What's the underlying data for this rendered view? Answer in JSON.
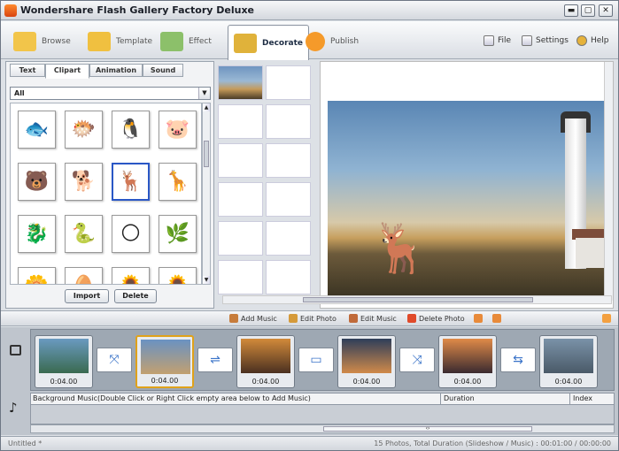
{
  "window": {
    "title": "Wondershare Flash Gallery Factory Deluxe",
    "minimize": "▬",
    "maximize": "▢",
    "close": "✕"
  },
  "toolbar": {
    "modes": [
      {
        "label": "Browse",
        "color": "#f2c54a"
      },
      {
        "label": "Template",
        "color": "#f0c040"
      },
      {
        "label": "Effect",
        "color": "#8cc06a"
      },
      {
        "label": "Decorate",
        "color": "#e0b23a",
        "active": true
      },
      {
        "label": "Publish",
        "color": "#f59a2a"
      }
    ],
    "file": "File",
    "settings": "Settings",
    "help": "Help"
  },
  "decorate": {
    "tabs": [
      "Text",
      "Clipart",
      "Animation",
      "Sound"
    ],
    "active_tab": "Clipart",
    "filter": "All",
    "cliparts": [
      {
        "icon": "black-fish-clipart",
        "glyph": "🐟"
      },
      {
        "icon": "sketch-fish-clipart",
        "glyph": "🐡"
      },
      {
        "icon": "penguin-clipart",
        "glyph": "🐧"
      },
      {
        "icon": "pig-clipart",
        "glyph": "🐷"
      },
      {
        "icon": "black-bear-clipart",
        "glyph": "🐻"
      },
      {
        "icon": "dog-clipart",
        "glyph": "🐕"
      },
      {
        "icon": "reindeer-clipart",
        "glyph": "🦌",
        "selected": true
      },
      {
        "icon": "giraffe-clipart",
        "glyph": "🦒"
      },
      {
        "icon": "seahorse-clipart",
        "glyph": "🐉"
      },
      {
        "icon": "snake-clipart",
        "glyph": "🐍"
      },
      {
        "icon": "moon-clipart",
        "glyph": "🌕"
      },
      {
        "icon": "leaves-clipart",
        "glyph": "🌿"
      },
      {
        "icon": "flowers-clipart",
        "glyph": "🌼"
      },
      {
        "icon": "egg-clipart",
        "glyph": "🥚"
      },
      {
        "icon": "flower-clipart",
        "glyph": "🌻"
      },
      {
        "icon": "sunflower-clipart",
        "glyph": "🌻"
      }
    ],
    "import": "Import",
    "delete": "Delete"
  },
  "editbar": {
    "add_music": "Add Music",
    "edit_photo": "Edit Photo",
    "edit_music": "Edit Music",
    "delete_photo": "Delete Photo"
  },
  "timeline": {
    "frames": [
      {
        "duration": "0:04.00",
        "colors": [
          "#6a9ac0",
          "#3a6a50"
        ]
      },
      {
        "duration": "0:04.00",
        "colors": [
          "#6a92c2",
          "#c2a070"
        ],
        "selected": true
      },
      {
        "duration": "0:04.00",
        "colors": [
          "#d28a3a",
          "#4a3020"
        ]
      },
      {
        "duration": "0:04.00",
        "colors": [
          "#2e3e5a",
          "#d08a4a"
        ]
      },
      {
        "duration": "0:04.00",
        "colors": [
          "#e08a48",
          "#3a2a30"
        ]
      },
      {
        "duration": "0:04.00",
        "colors": [
          "#7a92a8",
          "#4a5a68"
        ]
      }
    ],
    "transition_glyphs": [
      "⤧",
      "⇌",
      "▭",
      "⤨",
      "⇆"
    ],
    "music_header": {
      "col1": "Background Music(Double Click or Right Click empty area below to Add Music)",
      "col2": "Duration",
      "col3": "Index"
    }
  },
  "status": {
    "left": "Untitled *",
    "right": "15 Photos, Total Duration (Slideshow / Music) : 00:01:00 / 00:00:00"
  }
}
